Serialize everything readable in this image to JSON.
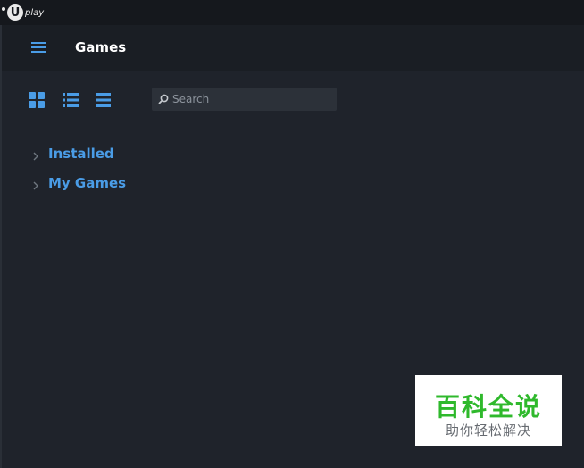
{
  "app": {
    "logo_text": "play",
    "logo_letter": "U"
  },
  "header": {
    "title": "Games",
    "menu_icon": "hamburger-icon"
  },
  "toolbar": {
    "view_modes": [
      {
        "icon": "grid-view-icon"
      },
      {
        "icon": "list-view-icon"
      },
      {
        "icon": "compact-list-icon"
      }
    ],
    "search": {
      "placeholder": "Search",
      "value": "",
      "icon": "search-icon"
    }
  },
  "tree": {
    "items": [
      {
        "label": "Installed",
        "icon": "chevron-right-icon"
      },
      {
        "label": "My Games",
        "icon": "chevron-right-icon"
      }
    ]
  },
  "watermark": {
    "main": "百科全说",
    "sub": "助你轻松解决"
  },
  "colors": {
    "accent": "#4a9ce6",
    "background": "#1f232b",
    "header": "#1a1e24",
    "titlebar": "#15181d",
    "watermark_green": "#2fb92c"
  }
}
